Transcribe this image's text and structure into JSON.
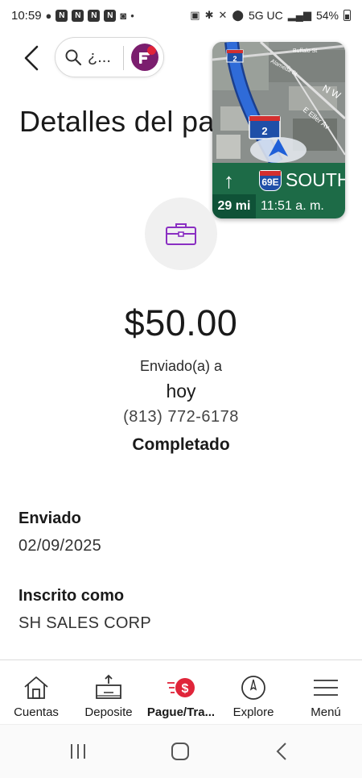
{
  "status_bar": {
    "time": "10:59",
    "notif_letters": [
      "N",
      "N",
      "N",
      "N"
    ],
    "network": "5G UC",
    "battery": "54%"
  },
  "top_bar": {
    "search_text": "¿...",
    "page_title": "Detalles del pa"
  },
  "map_overlay": {
    "street_1": "Buffalo St",
    "street_2": "Alameda St",
    "street_3": "E Eller Av",
    "compass": "N W",
    "route_number": "2",
    "highway": "69E",
    "direction": "SOUTH",
    "distance": "29 mi",
    "eta": "11:51 a. m."
  },
  "transaction": {
    "amount": "$50.00",
    "sent_to_label": "Enviado(a) a",
    "when": "hoy",
    "phone": "(813) 772-6178",
    "status": "Completado"
  },
  "details": [
    {
      "label": "Enviado",
      "value": "02/09/2025"
    },
    {
      "label": "Inscrito como",
      "value": "SH SALES CORP"
    }
  ],
  "tabs": [
    {
      "label": "Cuentas",
      "icon": "house-icon"
    },
    {
      "label": "Deposite",
      "icon": "deposit-check-icon"
    },
    {
      "label": "Pague/Tra...",
      "icon": "pay-transfer-icon"
    },
    {
      "label": "Explore",
      "icon": "compass-icon"
    },
    {
      "label": "Menú",
      "icon": "menu-icon"
    }
  ],
  "colors": {
    "brand_purple": "#7b1e6e",
    "accent_red": "#e0253a",
    "nav_green": "#1d6b47",
    "route_blue": "#2f6bd8"
  }
}
